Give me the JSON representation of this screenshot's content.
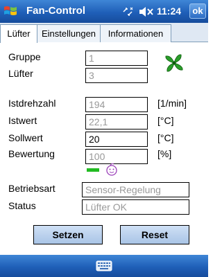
{
  "titlebar": {
    "app_title": "Fan-Control",
    "clock": "11:24",
    "ok_label": "ok",
    "icons": [
      "windows-start-icon",
      "network-icon",
      "volume-mute-icon"
    ]
  },
  "tabs": [
    {
      "label": "Lüfter",
      "active": true
    },
    {
      "label": "Einstellungen",
      "active": false
    },
    {
      "label": "Informationen",
      "active": false
    }
  ],
  "form": {
    "gruppe": {
      "label": "Gruppe",
      "value": "1"
    },
    "luefter": {
      "label": "Lüfter",
      "value": "3"
    },
    "istdrehzahl": {
      "label": "Istdrehzahl",
      "value": "194",
      "unit": "[1/min]"
    },
    "istwert": {
      "label": "Istwert",
      "value": "22,1",
      "unit": "[°C]"
    },
    "sollwert": {
      "label": "Sollwert",
      "value": "20",
      "unit": "[°C]"
    },
    "bewertung": {
      "label": "Bewertung",
      "value": "100",
      "unit": "[%]"
    },
    "betriebsart": {
      "label": "Betriebsart",
      "value": "Sensor-Regelung"
    },
    "status": {
      "label": "Status",
      "value": "Lüfter OK"
    }
  },
  "buttons": {
    "setzen": "Setzen",
    "reset": "Reset"
  },
  "colors": {
    "titlebar": "#1f5fb8",
    "fan": "#2a9d2a",
    "indicator": "#22bb22"
  }
}
